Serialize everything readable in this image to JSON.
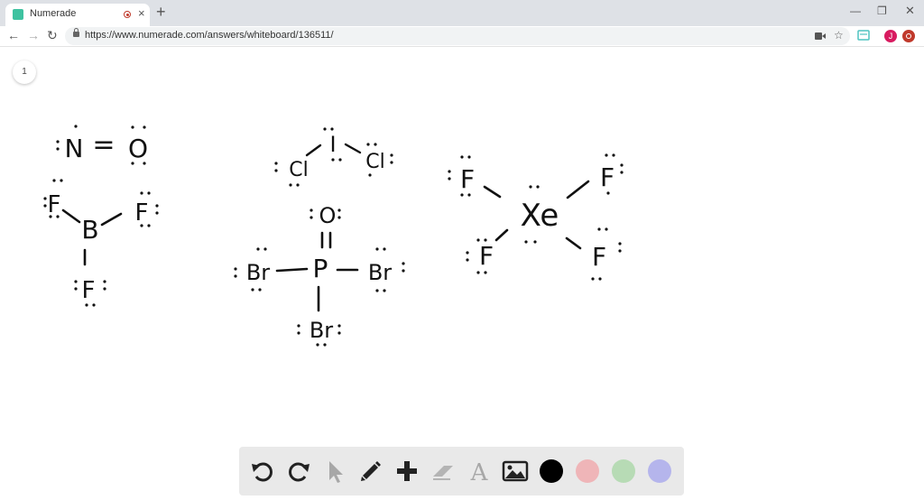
{
  "browser": {
    "tab_title": "Numerade",
    "url": "https://www.numerade.com/answers/whiteboard/136511/",
    "profile_initial": "J"
  },
  "whiteboard": {
    "page_number": "1",
    "structures": {
      "no": {
        "atom1": "N",
        "bond": "=",
        "atom2": "O"
      },
      "bf3": {
        "center": "B",
        "ligand": "F"
      },
      "icl2": {
        "center": "I",
        "ligand": "Cl"
      },
      "pobr3": {
        "center": "P",
        "oxygen": "O",
        "ligand": "Br"
      },
      "xef4": {
        "center": "Xe",
        "ligand": "F"
      }
    }
  },
  "toolbar": {
    "tools": [
      "undo-icon",
      "redo-icon",
      "pointer-icon",
      "pen-icon",
      "add-icon",
      "eraser-icon",
      "text-icon",
      "image-icon"
    ],
    "colors": [
      "#000000",
      "#efb5b8",
      "#b7dbb5",
      "#b5b5ec"
    ]
  }
}
